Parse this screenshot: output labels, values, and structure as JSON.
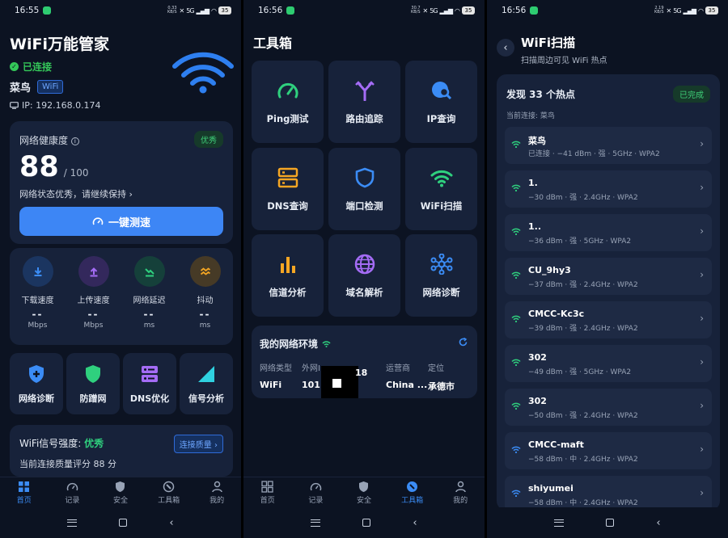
{
  "status_bars": [
    {
      "time": "16:55",
      "speed": [
        "0.33",
        "KB/S"
      ],
      "net": "5G",
      "battery": "35"
    },
    {
      "time": "16:56",
      "speed": [
        "30.7",
        "KB/S"
      ],
      "net": "5G",
      "battery": "35"
    },
    {
      "time": "16:56",
      "speed": [
        "2.19",
        "KB/S"
      ],
      "net": "5G",
      "battery": "35"
    }
  ],
  "tabs": [
    {
      "label": "首页",
      "icon": "grid-icon"
    },
    {
      "label": "记录",
      "icon": "gauge-icon"
    },
    {
      "label": "安全",
      "icon": "shield-icon"
    },
    {
      "label": "工具箱",
      "icon": "wrench-icon"
    },
    {
      "label": "我的",
      "icon": "person-icon"
    }
  ],
  "home": {
    "title": "WiFi万能管家",
    "status": "已连接",
    "ssid": "菜鸟",
    "ssid_tag": "WiFi",
    "ip": "IP: 192.168.0.174",
    "health": {
      "label": "网络健康度",
      "badge": "优秀",
      "score": "88",
      "max": "/ 100",
      "message": "网络状态优秀，请继续保持 ›",
      "button": "一键测速"
    },
    "stats": [
      {
        "name": "下载速度",
        "value": "--",
        "unit": "Mbps",
        "color": "#3b8cf5",
        "bg": "#1b3560"
      },
      {
        "name": "上传速度",
        "value": "--",
        "unit": "Mbps",
        "color": "#a46cf5",
        "bg": "#33285c"
      },
      {
        "name": "网络延迟",
        "value": "--",
        "unit": "ms",
        "color": "#2fd07e",
        "bg": "#15403a"
      },
      {
        "name": "抖动",
        "value": "--",
        "unit": "ms",
        "color": "#f5a623",
        "bg": "#463a26"
      }
    ],
    "quick": [
      {
        "label": "网络诊断",
        "icon": "shield-plus-icon",
        "color": "#3b8cf5"
      },
      {
        "label": "防蹭网",
        "icon": "shield-icon",
        "color": "#2fd07e"
      },
      {
        "label": "DNS优化",
        "icon": "server-icon",
        "color": "#a46cf5"
      },
      {
        "label": "信号分析",
        "icon": "signal-triangle-icon",
        "color": "#2fd1e0"
      }
    ],
    "wifi_strength": {
      "label": "WiFi信号强度: ",
      "value": "优秀",
      "button": "连接质量 ›",
      "score_text": "当前连接质量评分 88 分"
    }
  },
  "toolbox": {
    "title": "工具箱",
    "tools": [
      {
        "label": "Ping测试",
        "icon": "gauge-icon",
        "color": "#2fd07e"
      },
      {
        "label": "路由追踪",
        "icon": "route-fork-icon",
        "color": "#a46cf5"
      },
      {
        "label": "IP查询",
        "icon": "globe-search-icon",
        "color": "#3b8cf5"
      },
      {
        "label": "DNS查询",
        "icon": "server-icon",
        "color": "#f5a623"
      },
      {
        "label": "端口检测",
        "icon": "shield-icon",
        "color": "#3b8cf5"
      },
      {
        "label": "WiFi扫描",
        "icon": "wifi-icon",
        "color": "#2fd07e"
      },
      {
        "label": "信道分析",
        "icon": "bar-chart-icon",
        "color": "#f5a623"
      },
      {
        "label": "域名解析",
        "icon": "globe-icon",
        "color": "#a46cf5"
      },
      {
        "label": "网络诊断",
        "icon": "network-icon",
        "color": "#3b8cf5"
      }
    ],
    "network": {
      "title": "我的网络环境",
      "columns": [
        {
          "label": "网络类型",
          "value": "WiFi"
        },
        {
          "label": "外网I",
          "value": "101.1"
        },
        {
          "label": "",
          "value": "18"
        },
        {
          "label": "运营商",
          "value": "China ..."
        },
        {
          "label": "定位",
          "value": "承德市"
        }
      ]
    }
  },
  "scan": {
    "title": "WiFi扫描",
    "subtitle": "扫描周边可见 WiFi 热点",
    "found": "发现 33 个热点",
    "done": "已完成",
    "current": "当前连接: 菜鸟",
    "items": [
      {
        "name": "菜鸟",
        "detail": "已连接 · −41 dBm · 强 · 5GHz · WPA2",
        "color": "#2fd07e"
      },
      {
        "name": "1.",
        "detail": "−30 dBm · 强 · 2.4GHz · WPA2",
        "color": "#2fd07e"
      },
      {
        "name": "1..",
        "detail": "−36 dBm · 强 · 5GHz · WPA2",
        "color": "#2fd07e"
      },
      {
        "name": "CU_9hy3",
        "detail": "−37 dBm · 强 · 2.4GHz · WPA2",
        "color": "#2fd07e"
      },
      {
        "name": "CMCC-Kc3c",
        "detail": "−39 dBm · 强 · 2.4GHz · WPA2",
        "color": "#2fd07e"
      },
      {
        "name": "302",
        "detail": "−49 dBm · 强 · 5GHz · WPA2",
        "color": "#2fd07e"
      },
      {
        "name": "302",
        "detail": "−50 dBm · 强 · 2.4GHz · WPA2",
        "color": "#2fd07e"
      },
      {
        "name": "CMCC-maft",
        "detail": "−58 dBm · 中 · 2.4GHz · WPA2",
        "color": "#3b8cf5"
      },
      {
        "name": "shiyumei",
        "detail": "−58 dBm · 中 · 2.4GHz · WPA2",
        "color": "#3b8cf5"
      }
    ]
  }
}
